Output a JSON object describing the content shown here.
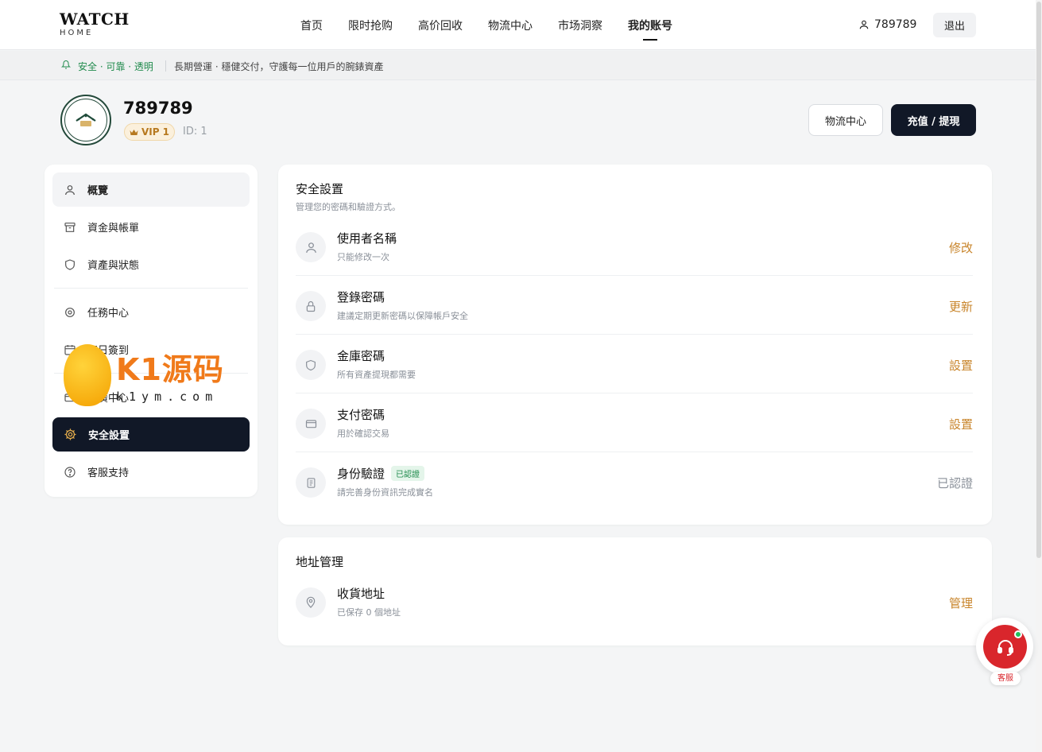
{
  "header": {
    "logo_line1": "WATCH",
    "logo_line2": "HOME",
    "nav": [
      "首页",
      "限时抢购",
      "高价回收",
      "物流中心",
      "市场洞察",
      "我的账号"
    ],
    "user": "789789",
    "logout": "退出"
  },
  "notice": {
    "tag": "安全 · 可靠 · 透明",
    "message": "長期營運 · 穩健交付，守護每一位用戶的腕錶資產"
  },
  "profile": {
    "username": "789789",
    "vip": "VIP 1",
    "id": "ID: 1",
    "logistics_button": "物流中心",
    "deposit_button": "充值 / 提現"
  },
  "sidebar": {
    "items": [
      {
        "label": "概覽",
        "icon": "user-icon"
      },
      {
        "label": "資金與帳單",
        "icon": "archive-icon"
      },
      {
        "label": "資產與狀態",
        "icon": "shield-icon"
      },
      {
        "label": "任務中心",
        "icon": "target-icon"
      },
      {
        "label": "每日簽到",
        "icon": "calendar-icon"
      },
      {
        "label": "推廣中心",
        "icon": "card-icon"
      },
      {
        "label": "安全設置",
        "icon": "gear-icon"
      },
      {
        "label": "客服支持",
        "icon": "help-icon"
      }
    ]
  },
  "security": {
    "title": "安全設置",
    "subtitle": "管理您的密碼和驗證方式。",
    "rows": [
      {
        "title": "使用者名稱",
        "desc": "只能修改一次",
        "action": "修改",
        "icon": "user-icon"
      },
      {
        "title": "登錄密碼",
        "desc": "建議定期更新密碼以保障帳戶安全",
        "action": "更新",
        "icon": "lock-icon"
      },
      {
        "title": "金庫密碼",
        "desc": "所有資產提現都需要",
        "action": "設置",
        "icon": "shield-icon"
      },
      {
        "title": "支付密碼",
        "desc": "用於確認交易",
        "action": "設置",
        "icon": "card-icon"
      },
      {
        "title": "身份驗證",
        "badge": "已認證",
        "desc": "請完善身份資訊完成實名",
        "action": "已認證",
        "icon": "document-icon"
      }
    ]
  },
  "address": {
    "title": "地址管理",
    "row": {
      "title": "收貨地址",
      "desc": "已保存 0 個地址",
      "action": "管理",
      "icon": "location-pin-icon"
    }
  },
  "support": {
    "label": "客服"
  },
  "watermark": {
    "line1": "K1源码",
    "line2": "k1ym.com"
  },
  "colors": {
    "accent": "#c8842a",
    "dark": "#111827",
    "green": "#1f8a4c",
    "support_red": "#d9262c"
  }
}
